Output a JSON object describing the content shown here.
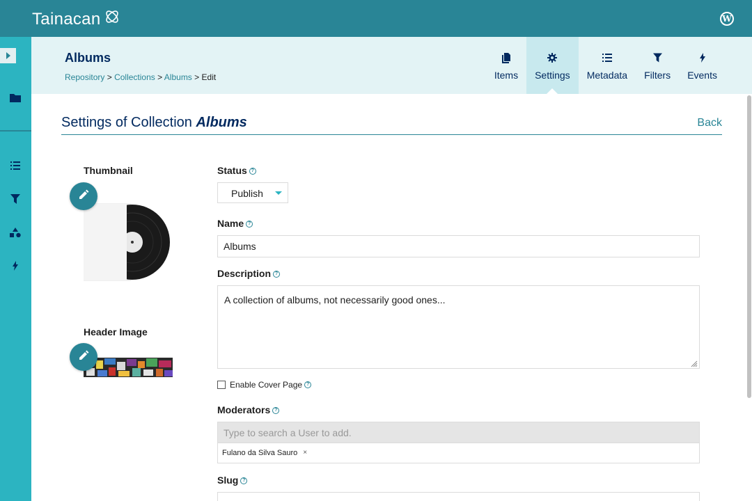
{
  "app": {
    "logo_text": "Tainacan"
  },
  "header": {
    "title": "Albums",
    "breadcrumb": {
      "repository": "Repository",
      "collections": "Collections",
      "albums": "Albums",
      "current": "Edit",
      "sep": ">"
    },
    "tabs": [
      {
        "label": "Items",
        "icon": "items-icon",
        "active": false
      },
      {
        "label": "Settings",
        "icon": "gear-icon",
        "active": true
      },
      {
        "label": "Metadata",
        "icon": "metadata-list-icon",
        "active": false
      },
      {
        "label": "Filters",
        "icon": "filter-icon",
        "active": false
      },
      {
        "label": "Events",
        "icon": "lightning-icon",
        "active": false
      }
    ]
  },
  "page": {
    "title_prefix": "Settings of Collection ",
    "title_collection": "Albums",
    "back_label": "Back"
  },
  "form": {
    "thumbnail_label": "Thumbnail",
    "header_image_label": "Header Image",
    "status_label": "Status",
    "status_value": "Publish",
    "name_label": "Name",
    "name_value": "Albums",
    "description_label": "Description",
    "description_value": "A collection of albums, not necessarily good ones...",
    "cover_page_label": "Enable Cover Page",
    "cover_page_checked": false,
    "moderators_label": "Moderators",
    "moderators_placeholder": "Type to search a User to add.",
    "moderators": [
      {
        "name": "Fulano da Silva Sauro",
        "remove": "×"
      }
    ],
    "slug_label": "Slug",
    "help_glyph": "?"
  },
  "colors": {
    "primary": "#298596",
    "accent": "#2cb4c1",
    "title": "#01295f",
    "subheader_bg": "#e3f3f5",
    "active_tab_bg": "#c8e9ee"
  }
}
